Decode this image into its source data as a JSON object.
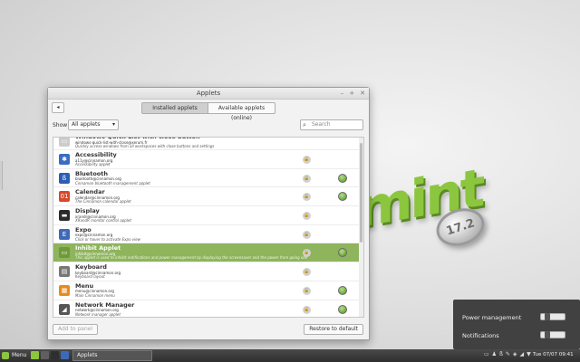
{
  "desktop": {
    "logo_text": "mint",
    "badge_text": "17.2"
  },
  "window": {
    "title": "Applets",
    "controls": [
      "–",
      "+",
      "✕"
    ],
    "back_label": "◂",
    "tabs": [
      {
        "label": "Installed applets",
        "active": true
      },
      {
        "label": "Available applets (online)",
        "active": false
      }
    ],
    "filter": {
      "show_label": "Show",
      "selected": "All applets",
      "search_placeholder": "Search"
    },
    "applets": [
      {
        "name": "Windows Quick List with close button",
        "uuid": "windows-quick-list-with-close@xerum.fr",
        "desc": "Quickly access windows from all workspaces with close buttons and settings",
        "icon_color": "#cccccc",
        "icon": "▭",
        "locked": false,
        "enabled": false,
        "selected": false,
        "partial": true
      },
      {
        "name": "Accessibility",
        "uuid": "a11y@cinnamon.org",
        "desc": "Accessibility applet",
        "icon_color": "#3a6cc2",
        "icon": "✱",
        "locked": true,
        "enabled": false,
        "selected": false
      },
      {
        "name": "Bluetooth",
        "uuid": "bluetooth@cinnamon.org",
        "desc": "Cinnamon bluetooth management applet",
        "icon_color": "#2b5fb5",
        "icon": "ß",
        "locked": true,
        "enabled": true,
        "selected": false
      },
      {
        "name": "Calendar",
        "uuid": "calendar@cinnamon.org",
        "desc": "The Cinnamon calendar applet",
        "icon_color": "#d9472b",
        "icon": "01",
        "locked": true,
        "enabled": true,
        "selected": false
      },
      {
        "name": "Display",
        "uuid": "xrandr@cinnamon.org",
        "desc": "XRandR monitor control applet",
        "icon_color": "#2a2a2a",
        "icon": "▬",
        "locked": true,
        "enabled": false,
        "selected": false
      },
      {
        "name": "Expo",
        "uuid": "expo@cinnamon.org",
        "desc": "Click or hover to activate Expo view",
        "icon_color": "#3d6ab8",
        "icon": "E",
        "locked": true,
        "enabled": false,
        "selected": false
      },
      {
        "name": "Inhibit Applet",
        "uuid": "inhibit@cinnamon.org",
        "desc": "This applet is used to inhibit notifications and power management by displaying the screensaver and the power from going idle",
        "icon_color": "#6e9a3c",
        "icon": "▭",
        "locked": true,
        "enabled": true,
        "selected": true
      },
      {
        "name": "Keyboard",
        "uuid": "keyboard@cinnamon.org",
        "desc": "Keyboard layout",
        "icon_color": "#777777",
        "icon": "▤",
        "locked": true,
        "enabled": false,
        "selected": false
      },
      {
        "name": "Menu",
        "uuid": "menu@cinnamon.org",
        "desc": "Main Cinnamon menu",
        "icon_color": "#e88a1d",
        "icon": "▦",
        "locked": true,
        "enabled": true,
        "selected": false
      },
      {
        "name": "Network Manager",
        "uuid": "network@cinnamon.org",
        "desc": "Network manager applet",
        "icon_color": "#555555",
        "icon": "◢",
        "locked": true,
        "enabled": true,
        "selected": false
      }
    ],
    "add_label": "Add to panel",
    "restore_label": "Restore to default"
  },
  "popup": {
    "items": [
      {
        "label": "Power management"
      },
      {
        "label": "Notifications"
      }
    ]
  },
  "taskbar": {
    "menu_label": "Menu",
    "launcher_colors": [
      "#8cc63f",
      "#5f5f5f",
      "#2f2f2f",
      "#3d6ab8"
    ],
    "task_label": "Applets",
    "tray_icons": [
      "▭",
      "♟",
      "ß",
      "✎",
      "◈",
      "◢",
      "▼"
    ],
    "clock": "Tue 07/07 09:41"
  }
}
